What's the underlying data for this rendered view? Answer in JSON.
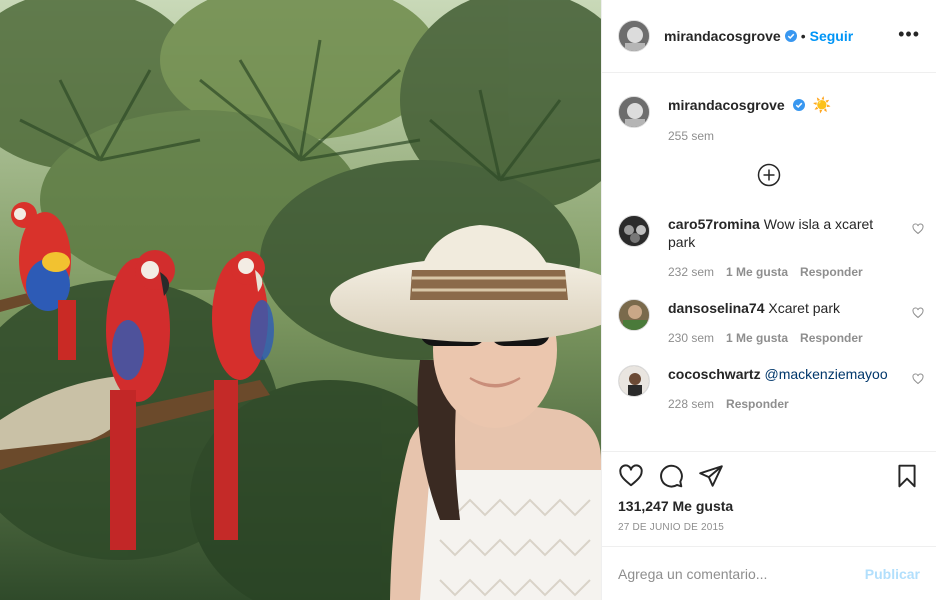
{
  "post": {
    "author": "mirandacosgrove",
    "follow_label": "Seguir",
    "separator": "•",
    "more_label": "•••",
    "caption_emoji": "☀️",
    "caption_time": "255 sem",
    "likes": "131,247 Me gusta",
    "date": "27 DE JUNIO DE 2015"
  },
  "comments": [
    {
      "user": "caro57romina",
      "text": "Wow isla a xcaret park",
      "mention": "",
      "time": "232 sem",
      "likes": "1 Me gusta",
      "reply": "Responder"
    },
    {
      "user": "dansoselina74",
      "text": "Xcaret park",
      "mention": "",
      "time": "230 sem",
      "likes": "1 Me gusta",
      "reply": "Responder"
    },
    {
      "user": "cocoschwartz",
      "text": "",
      "mention": "@mackenziemayoo",
      "time": "228 sem",
      "likes": "",
      "reply": "Responder"
    }
  ],
  "composer": {
    "placeholder": "Agrega un comentario...",
    "publish_label": "Publicar"
  },
  "icons": {
    "verified": "verified-badge-icon",
    "load_more": "plus-circle-icon",
    "like": "heart-icon",
    "comment": "comment-bubble-icon",
    "share": "paper-plane-icon",
    "save": "bookmark-icon"
  },
  "colors": {
    "accent": "#0095f6",
    "publish_disabled": "#b2dffc",
    "muted": "#8e8e8e",
    "text": "#262626"
  }
}
